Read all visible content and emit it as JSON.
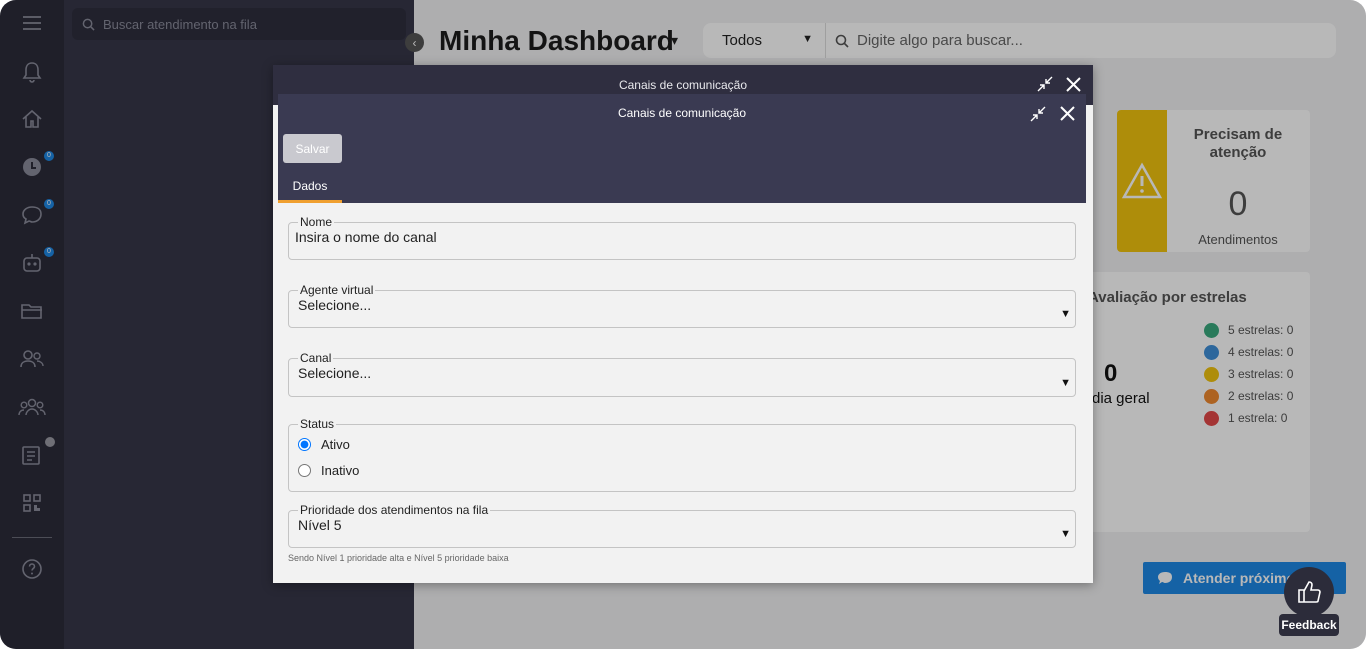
{
  "queue": {
    "search_placeholder": "Buscar atendimento na fila"
  },
  "rail": {
    "items": [
      {
        "icon": "menu-icon"
      },
      {
        "icon": "bell-icon"
      },
      {
        "icon": "home-icon"
      },
      {
        "icon": "clock-icon",
        "badge": "0"
      },
      {
        "icon": "chat-icon",
        "badge": "0"
      },
      {
        "icon": "robot-icon",
        "badge": "0"
      },
      {
        "icon": "folder-icon"
      },
      {
        "icon": "users-icon"
      },
      {
        "icon": "team-icon"
      },
      {
        "icon": "contacts-icon"
      },
      {
        "icon": "qrcode-icon"
      },
      {
        "icon": "help-icon"
      }
    ]
  },
  "dashboard": {
    "title": "Minha Dashboard",
    "filter_value": "Todos",
    "search_placeholder": "Digite algo para buscar..."
  },
  "attention_card": {
    "title": "Precisam de atenção",
    "value": "0",
    "label": "Atendimentos",
    "color": "#f2c40f"
  },
  "stars_card": {
    "title": "Avaliação por estrelas",
    "average": "0",
    "average_label": "dia geral",
    "legend": [
      {
        "label": "5 estrelas: 0",
        "color": "#3aaa7e"
      },
      {
        "label": "4 estrelas: 0",
        "color": "#3f8fd8"
      },
      {
        "label": "3 estrelas: 0",
        "color": "#f2c40f"
      },
      {
        "label": "2 estrelas: 0",
        "color": "#f08a30"
      },
      {
        "label": "1 estrela: 0",
        "color": "#e44848"
      }
    ]
  },
  "next_button": {
    "label": "Atender próximo"
  },
  "feedback": {
    "label": "Feedback"
  },
  "back_modal": {
    "title": "Canais de comunicação"
  },
  "modal": {
    "title": "Canais de comunicação",
    "save_label": "Salvar",
    "tab_label": "Dados",
    "nome": {
      "label": "Nome",
      "placeholder": "Insira o nome do canal"
    },
    "agente": {
      "label": "Agente virtual",
      "value": "Selecione..."
    },
    "canal": {
      "label": "Canal",
      "value": "Selecione..."
    },
    "status": {
      "label": "Status",
      "options": [
        "Ativo",
        "Inativo"
      ],
      "selected": "Ativo"
    },
    "prioridade": {
      "label": "Prioridade dos atendimentos na fila",
      "value": "Nível 5"
    },
    "hint": "Sendo Nível 1 prioridade alta e Nível 5 prioridade baixa"
  }
}
